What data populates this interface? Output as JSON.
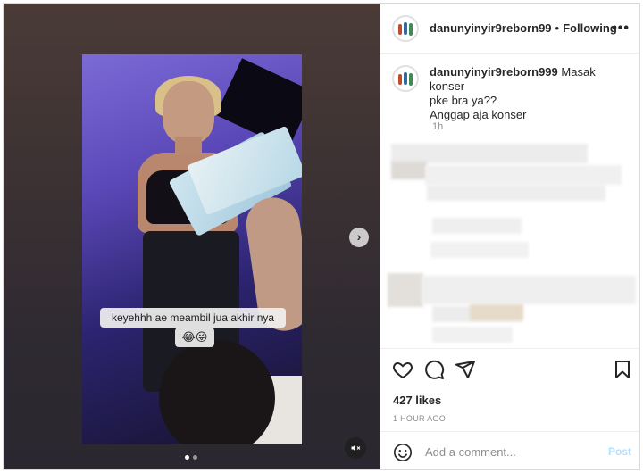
{
  "post": {
    "username": "danunyinyir9reborn99",
    "separator": "•",
    "follow_label": "Following",
    "more_icon": "more-horizontal-icon"
  },
  "caption": {
    "username": "danunyinyir9reborn999",
    "line1": "Masak konser",
    "line2": "pke bra ya??",
    "line3": "Anggap aja konser",
    "time": "1h"
  },
  "video": {
    "overlay_caption": "keyehhh ae meambil jua akhir nya",
    "overlay_emoji": "😂😜",
    "carousel_count": 2,
    "carousel_active": 1
  },
  "actions": {
    "likes": "427 likes",
    "time_ago": "1 HOUR AGO"
  },
  "comment_box": {
    "placeholder": "Add a comment...",
    "post_label": "Post",
    "post_color": "#b2dffc"
  },
  "icons": {
    "like": "heart-icon",
    "comment": "comment-bubble-icon",
    "share": "paper-plane-icon",
    "save": "bookmark-icon",
    "next": "chevron-right-icon",
    "mute": "speaker-muted-icon",
    "emoji": "emoji-smile-icon"
  }
}
